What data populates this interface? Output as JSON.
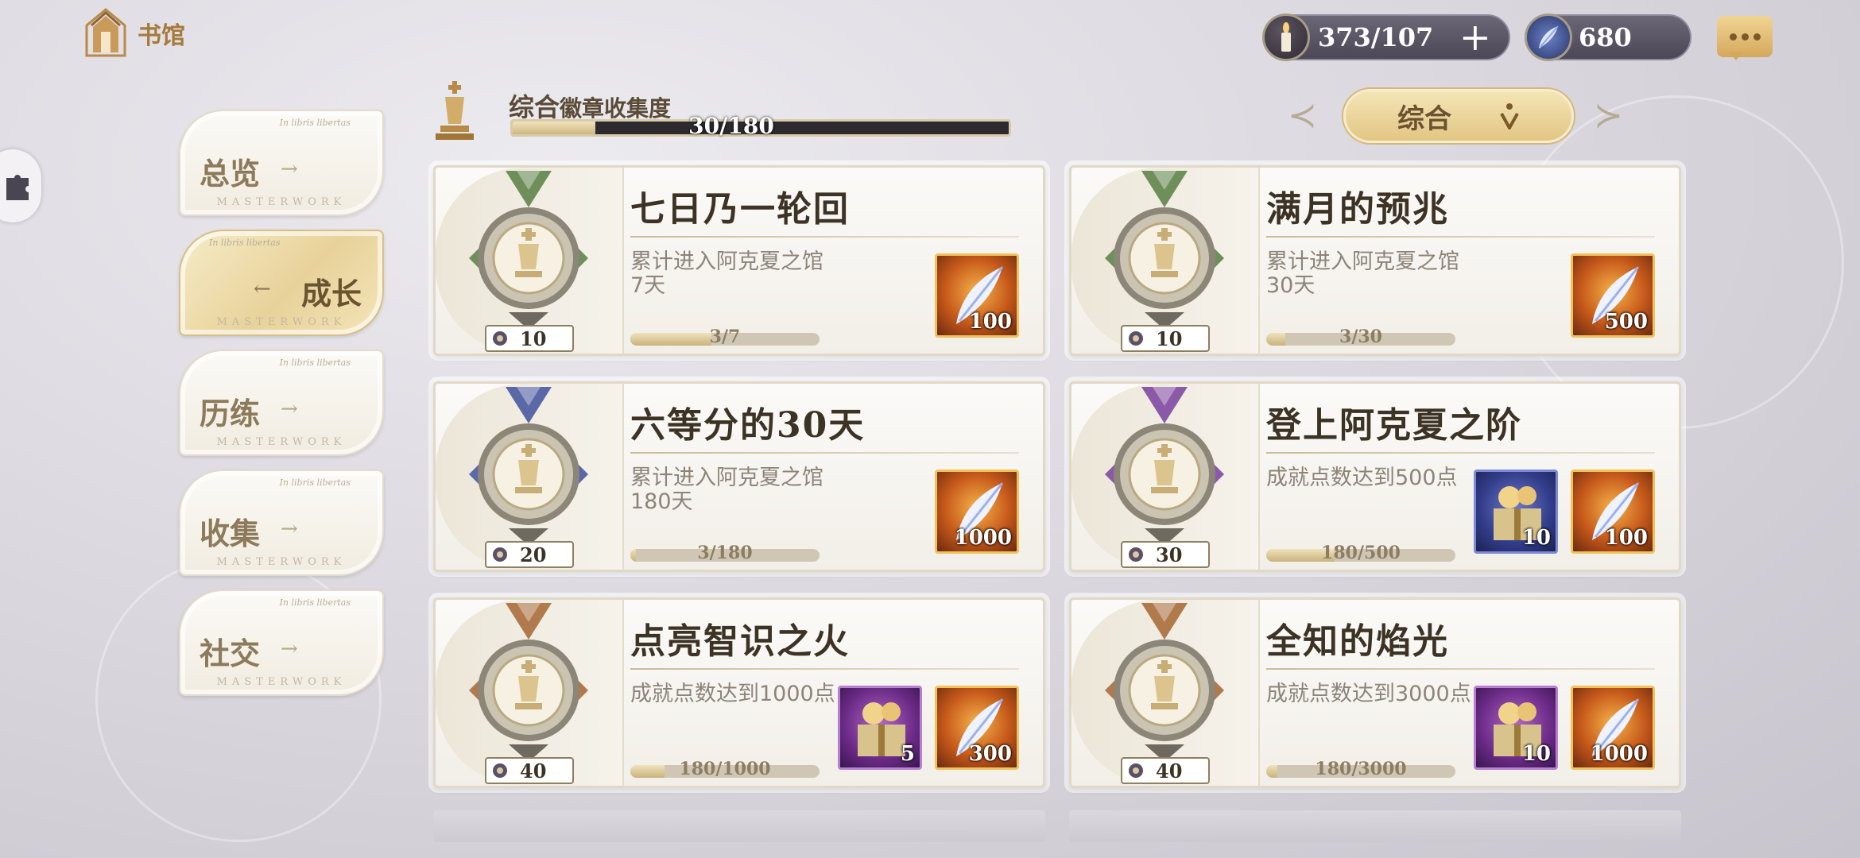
{
  "header": {
    "home_label": "书馆",
    "candles": "373/107",
    "crystals": "680"
  },
  "nav": [
    {
      "label": "总览",
      "tagline": "In libris libertas",
      "sub": "MASTERWORK",
      "active": false
    },
    {
      "label": "成长",
      "tagline": "In libris libertas",
      "sub": "MASTERWORK",
      "active": true
    },
    {
      "label": "历练",
      "tagline": "In libris libertas",
      "sub": "MASTERWORK",
      "active": false
    },
    {
      "label": "收集",
      "tagline": "In libris libertas",
      "sub": "MASTERWORK",
      "active": false
    },
    {
      "label": "社交",
      "tagline": "In libris libertas",
      "sub": "MASTERWORK",
      "active": false
    }
  ],
  "collection": {
    "title_main": "综合",
    "title_sub": "徽章收集度",
    "progress_text": "30/180",
    "progress": 0.1667
  },
  "filter": {
    "label": "综合"
  },
  "achievements": [
    {
      "title": "七日乃一轮回",
      "desc": "累计进入阿克夏之馆7天",
      "points": "10",
      "progress_text": "3/7",
      "progress": 0.4286,
      "ribbon": "#6f8f5a",
      "rewards": [
        {
          "type": "orange",
          "qty": "100"
        }
      ]
    },
    {
      "title": "满月的预兆",
      "desc": "累计进入阿克夏之馆30天",
      "points": "10",
      "progress_text": "3/30",
      "progress": 0.1,
      "ribbon": "#6f8f5a",
      "rewards": [
        {
          "type": "orange",
          "qty": "500"
        }
      ]
    },
    {
      "title": "六等分的30天",
      "desc": "累计进入阿克夏之馆180天",
      "points": "20",
      "progress_text": "3/180",
      "progress": 0.0167,
      "ribbon": "#5a68a8",
      "rewards": [
        {
          "type": "orange",
          "qty": "1000"
        }
      ]
    },
    {
      "title": "登上阿克夏之阶",
      "desc": "成就点数达到500点",
      "points": "30",
      "progress_text": "180/500",
      "progress": 0.36,
      "ribbon": "#8a5aa8",
      "rewards": [
        {
          "type": "blue",
          "qty": "10"
        },
        {
          "type": "orange",
          "qty": "100"
        }
      ]
    },
    {
      "title": "点亮智识之火",
      "desc": "成就点数达到1000点",
      "points": "40",
      "progress_text": "180/1000",
      "progress": 0.18,
      "ribbon": "#b07a4c",
      "rewards": [
        {
          "type": "purple",
          "qty": "5"
        },
        {
          "type": "orange",
          "qty": "300"
        }
      ]
    },
    {
      "title": "全知的焰光",
      "desc": "成就点数达到3000点",
      "points": "40",
      "progress_text": "180/3000",
      "progress": 0.06,
      "ribbon": "#b07a4c",
      "rewards": [
        {
          "type": "purple",
          "qty": "10"
        },
        {
          "type": "orange",
          "qty": "1000"
        }
      ]
    }
  ]
}
